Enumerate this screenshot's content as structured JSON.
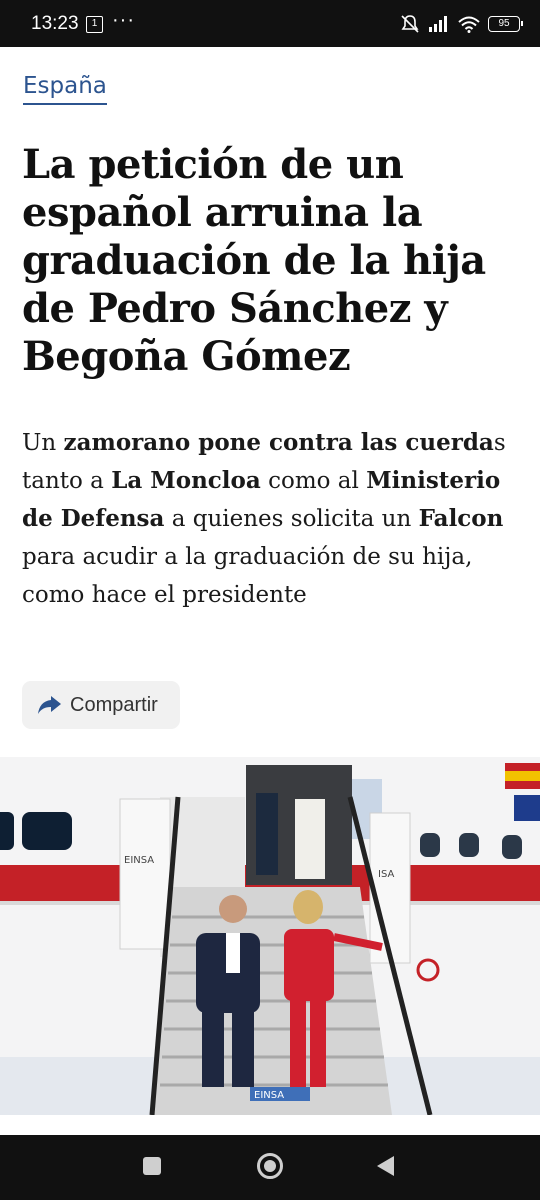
{
  "status_bar": {
    "time": "13:23",
    "sim_badge": "1",
    "overflow": "···",
    "battery": "95",
    "icons": [
      "sim-card-icon",
      "more-icon",
      "muted-bell-icon",
      "signal-icon",
      "wifi-icon",
      "battery-icon"
    ]
  },
  "article": {
    "section": "España",
    "headline": "La petición de un español arruina la graduación de la hija de Pedro Sánchez y Begoña Gómez",
    "subtitle": {
      "p1": "Un ",
      "b1": "zamorano pone contra las cuerda",
      "p2": "s tanto a ",
      "b2": "La Moncloa",
      "p3": " como al ",
      "b3": "Ministerio de Defensa",
      "p4": " a quienes solicita un ",
      "b4": "Falcon",
      "p5": " para acudir a la graduación de su hija, como hace el presidente"
    },
    "share_label": "Compartir",
    "share_icon": "share-arrow-icon"
  },
  "photo": {
    "plane_label_left": "EINSA",
    "plane_label_right": "ISA",
    "stair_label": "EINSA"
  },
  "nav_bar": {
    "icons": [
      "recent-apps-icon",
      "home-icon",
      "back-icon"
    ]
  },
  "colors": {
    "section_link": "#2c548f",
    "headline": "#111111",
    "bars": "#111111",
    "plane_stripe": "#c42127",
    "suit_red": "#d1202f"
  }
}
